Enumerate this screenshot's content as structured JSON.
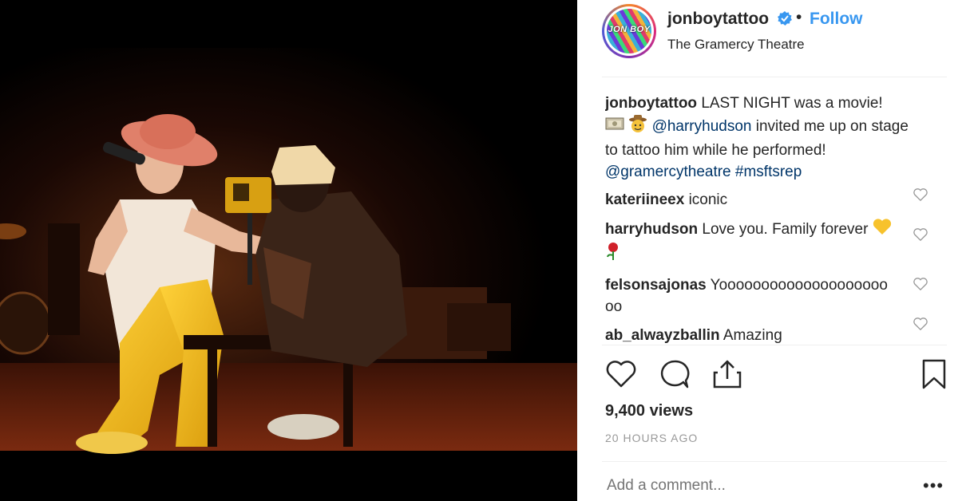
{
  "post": {
    "username": "jonboytattoo",
    "avatar_text": "JON BOY",
    "follow_label": "Follow",
    "separator": "•",
    "location": "The Gramercy Theatre",
    "caption": {
      "user": "jonboytattoo",
      "text_1": "LAST NIGHT was a movie!",
      "mention": "@harryhudson",
      "text_2": "invited me up on stage to tattoo him while he performed!",
      "tag_1": "@gramercytheatre",
      "tag_2": "#msftsrep"
    },
    "comments": [
      {
        "user": "kateriineex",
        "text": "iconic"
      },
      {
        "user": "harryhudson",
        "text": "Love you. Family forever"
      },
      {
        "user": "felsonsajonas",
        "text": "Yoooooooooooooooooooooo"
      },
      {
        "user": "ab_alwayzballin",
        "text": "Amazing"
      }
    ],
    "views": "9,400 views",
    "time": "20 HOURS AGO",
    "add_comment_placeholder": "Add a comment...",
    "more_label": "•••"
  },
  "icons": {
    "verified": "verified-badge-icon",
    "like": "heart-icon",
    "comment": "comment-bubble-icon",
    "share": "share-icon",
    "save": "bookmark-icon"
  },
  "colors": {
    "follow": "#3897f0",
    "link": "#003569",
    "verified": "#3897f0",
    "muted": "#999999"
  }
}
